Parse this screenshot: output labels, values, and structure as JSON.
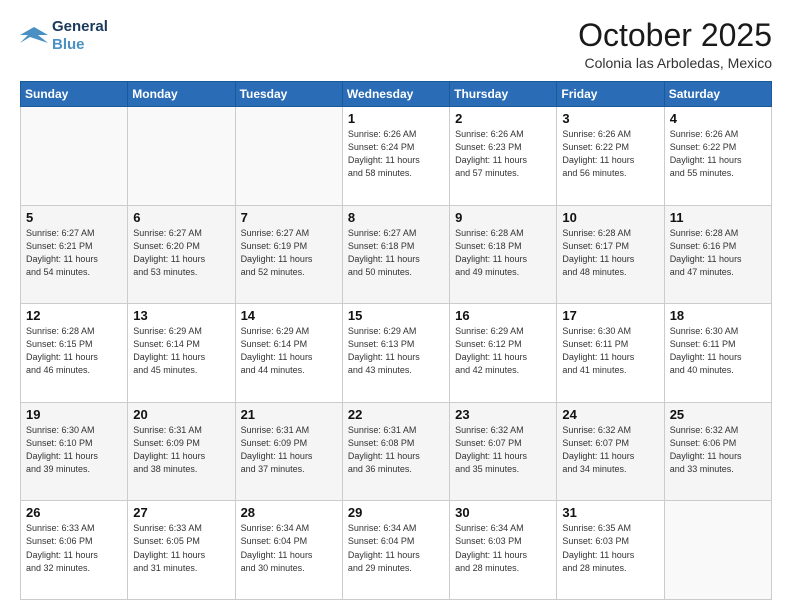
{
  "header": {
    "logo_line1": "General",
    "logo_line2": "Blue",
    "month": "October 2025",
    "location": "Colonia las Arboledas, Mexico"
  },
  "weekdays": [
    "Sunday",
    "Monday",
    "Tuesday",
    "Wednesday",
    "Thursday",
    "Friday",
    "Saturday"
  ],
  "weeks": [
    [
      {
        "day": "",
        "info": ""
      },
      {
        "day": "",
        "info": ""
      },
      {
        "day": "",
        "info": ""
      },
      {
        "day": "1",
        "info": "Sunrise: 6:26 AM\nSunset: 6:24 PM\nDaylight: 11 hours\nand 58 minutes."
      },
      {
        "day": "2",
        "info": "Sunrise: 6:26 AM\nSunset: 6:23 PM\nDaylight: 11 hours\nand 57 minutes."
      },
      {
        "day": "3",
        "info": "Sunrise: 6:26 AM\nSunset: 6:22 PM\nDaylight: 11 hours\nand 56 minutes."
      },
      {
        "day": "4",
        "info": "Sunrise: 6:26 AM\nSunset: 6:22 PM\nDaylight: 11 hours\nand 55 minutes."
      }
    ],
    [
      {
        "day": "5",
        "info": "Sunrise: 6:27 AM\nSunset: 6:21 PM\nDaylight: 11 hours\nand 54 minutes."
      },
      {
        "day": "6",
        "info": "Sunrise: 6:27 AM\nSunset: 6:20 PM\nDaylight: 11 hours\nand 53 minutes."
      },
      {
        "day": "7",
        "info": "Sunrise: 6:27 AM\nSunset: 6:19 PM\nDaylight: 11 hours\nand 52 minutes."
      },
      {
        "day": "8",
        "info": "Sunrise: 6:27 AM\nSunset: 6:18 PM\nDaylight: 11 hours\nand 50 minutes."
      },
      {
        "day": "9",
        "info": "Sunrise: 6:28 AM\nSunset: 6:18 PM\nDaylight: 11 hours\nand 49 minutes."
      },
      {
        "day": "10",
        "info": "Sunrise: 6:28 AM\nSunset: 6:17 PM\nDaylight: 11 hours\nand 48 minutes."
      },
      {
        "day": "11",
        "info": "Sunrise: 6:28 AM\nSunset: 6:16 PM\nDaylight: 11 hours\nand 47 minutes."
      }
    ],
    [
      {
        "day": "12",
        "info": "Sunrise: 6:28 AM\nSunset: 6:15 PM\nDaylight: 11 hours\nand 46 minutes."
      },
      {
        "day": "13",
        "info": "Sunrise: 6:29 AM\nSunset: 6:14 PM\nDaylight: 11 hours\nand 45 minutes."
      },
      {
        "day": "14",
        "info": "Sunrise: 6:29 AM\nSunset: 6:14 PM\nDaylight: 11 hours\nand 44 minutes."
      },
      {
        "day": "15",
        "info": "Sunrise: 6:29 AM\nSunset: 6:13 PM\nDaylight: 11 hours\nand 43 minutes."
      },
      {
        "day": "16",
        "info": "Sunrise: 6:29 AM\nSunset: 6:12 PM\nDaylight: 11 hours\nand 42 minutes."
      },
      {
        "day": "17",
        "info": "Sunrise: 6:30 AM\nSunset: 6:11 PM\nDaylight: 11 hours\nand 41 minutes."
      },
      {
        "day": "18",
        "info": "Sunrise: 6:30 AM\nSunset: 6:11 PM\nDaylight: 11 hours\nand 40 minutes."
      }
    ],
    [
      {
        "day": "19",
        "info": "Sunrise: 6:30 AM\nSunset: 6:10 PM\nDaylight: 11 hours\nand 39 minutes."
      },
      {
        "day": "20",
        "info": "Sunrise: 6:31 AM\nSunset: 6:09 PM\nDaylight: 11 hours\nand 38 minutes."
      },
      {
        "day": "21",
        "info": "Sunrise: 6:31 AM\nSunset: 6:09 PM\nDaylight: 11 hours\nand 37 minutes."
      },
      {
        "day": "22",
        "info": "Sunrise: 6:31 AM\nSunset: 6:08 PM\nDaylight: 11 hours\nand 36 minutes."
      },
      {
        "day": "23",
        "info": "Sunrise: 6:32 AM\nSunset: 6:07 PM\nDaylight: 11 hours\nand 35 minutes."
      },
      {
        "day": "24",
        "info": "Sunrise: 6:32 AM\nSunset: 6:07 PM\nDaylight: 11 hours\nand 34 minutes."
      },
      {
        "day": "25",
        "info": "Sunrise: 6:32 AM\nSunset: 6:06 PM\nDaylight: 11 hours\nand 33 minutes."
      }
    ],
    [
      {
        "day": "26",
        "info": "Sunrise: 6:33 AM\nSunset: 6:06 PM\nDaylight: 11 hours\nand 32 minutes."
      },
      {
        "day": "27",
        "info": "Sunrise: 6:33 AM\nSunset: 6:05 PM\nDaylight: 11 hours\nand 31 minutes."
      },
      {
        "day": "28",
        "info": "Sunrise: 6:34 AM\nSunset: 6:04 PM\nDaylight: 11 hours\nand 30 minutes."
      },
      {
        "day": "29",
        "info": "Sunrise: 6:34 AM\nSunset: 6:04 PM\nDaylight: 11 hours\nand 29 minutes."
      },
      {
        "day": "30",
        "info": "Sunrise: 6:34 AM\nSunset: 6:03 PM\nDaylight: 11 hours\nand 28 minutes."
      },
      {
        "day": "31",
        "info": "Sunrise: 6:35 AM\nSunset: 6:03 PM\nDaylight: 11 hours\nand 28 minutes."
      },
      {
        "day": "",
        "info": ""
      }
    ]
  ]
}
